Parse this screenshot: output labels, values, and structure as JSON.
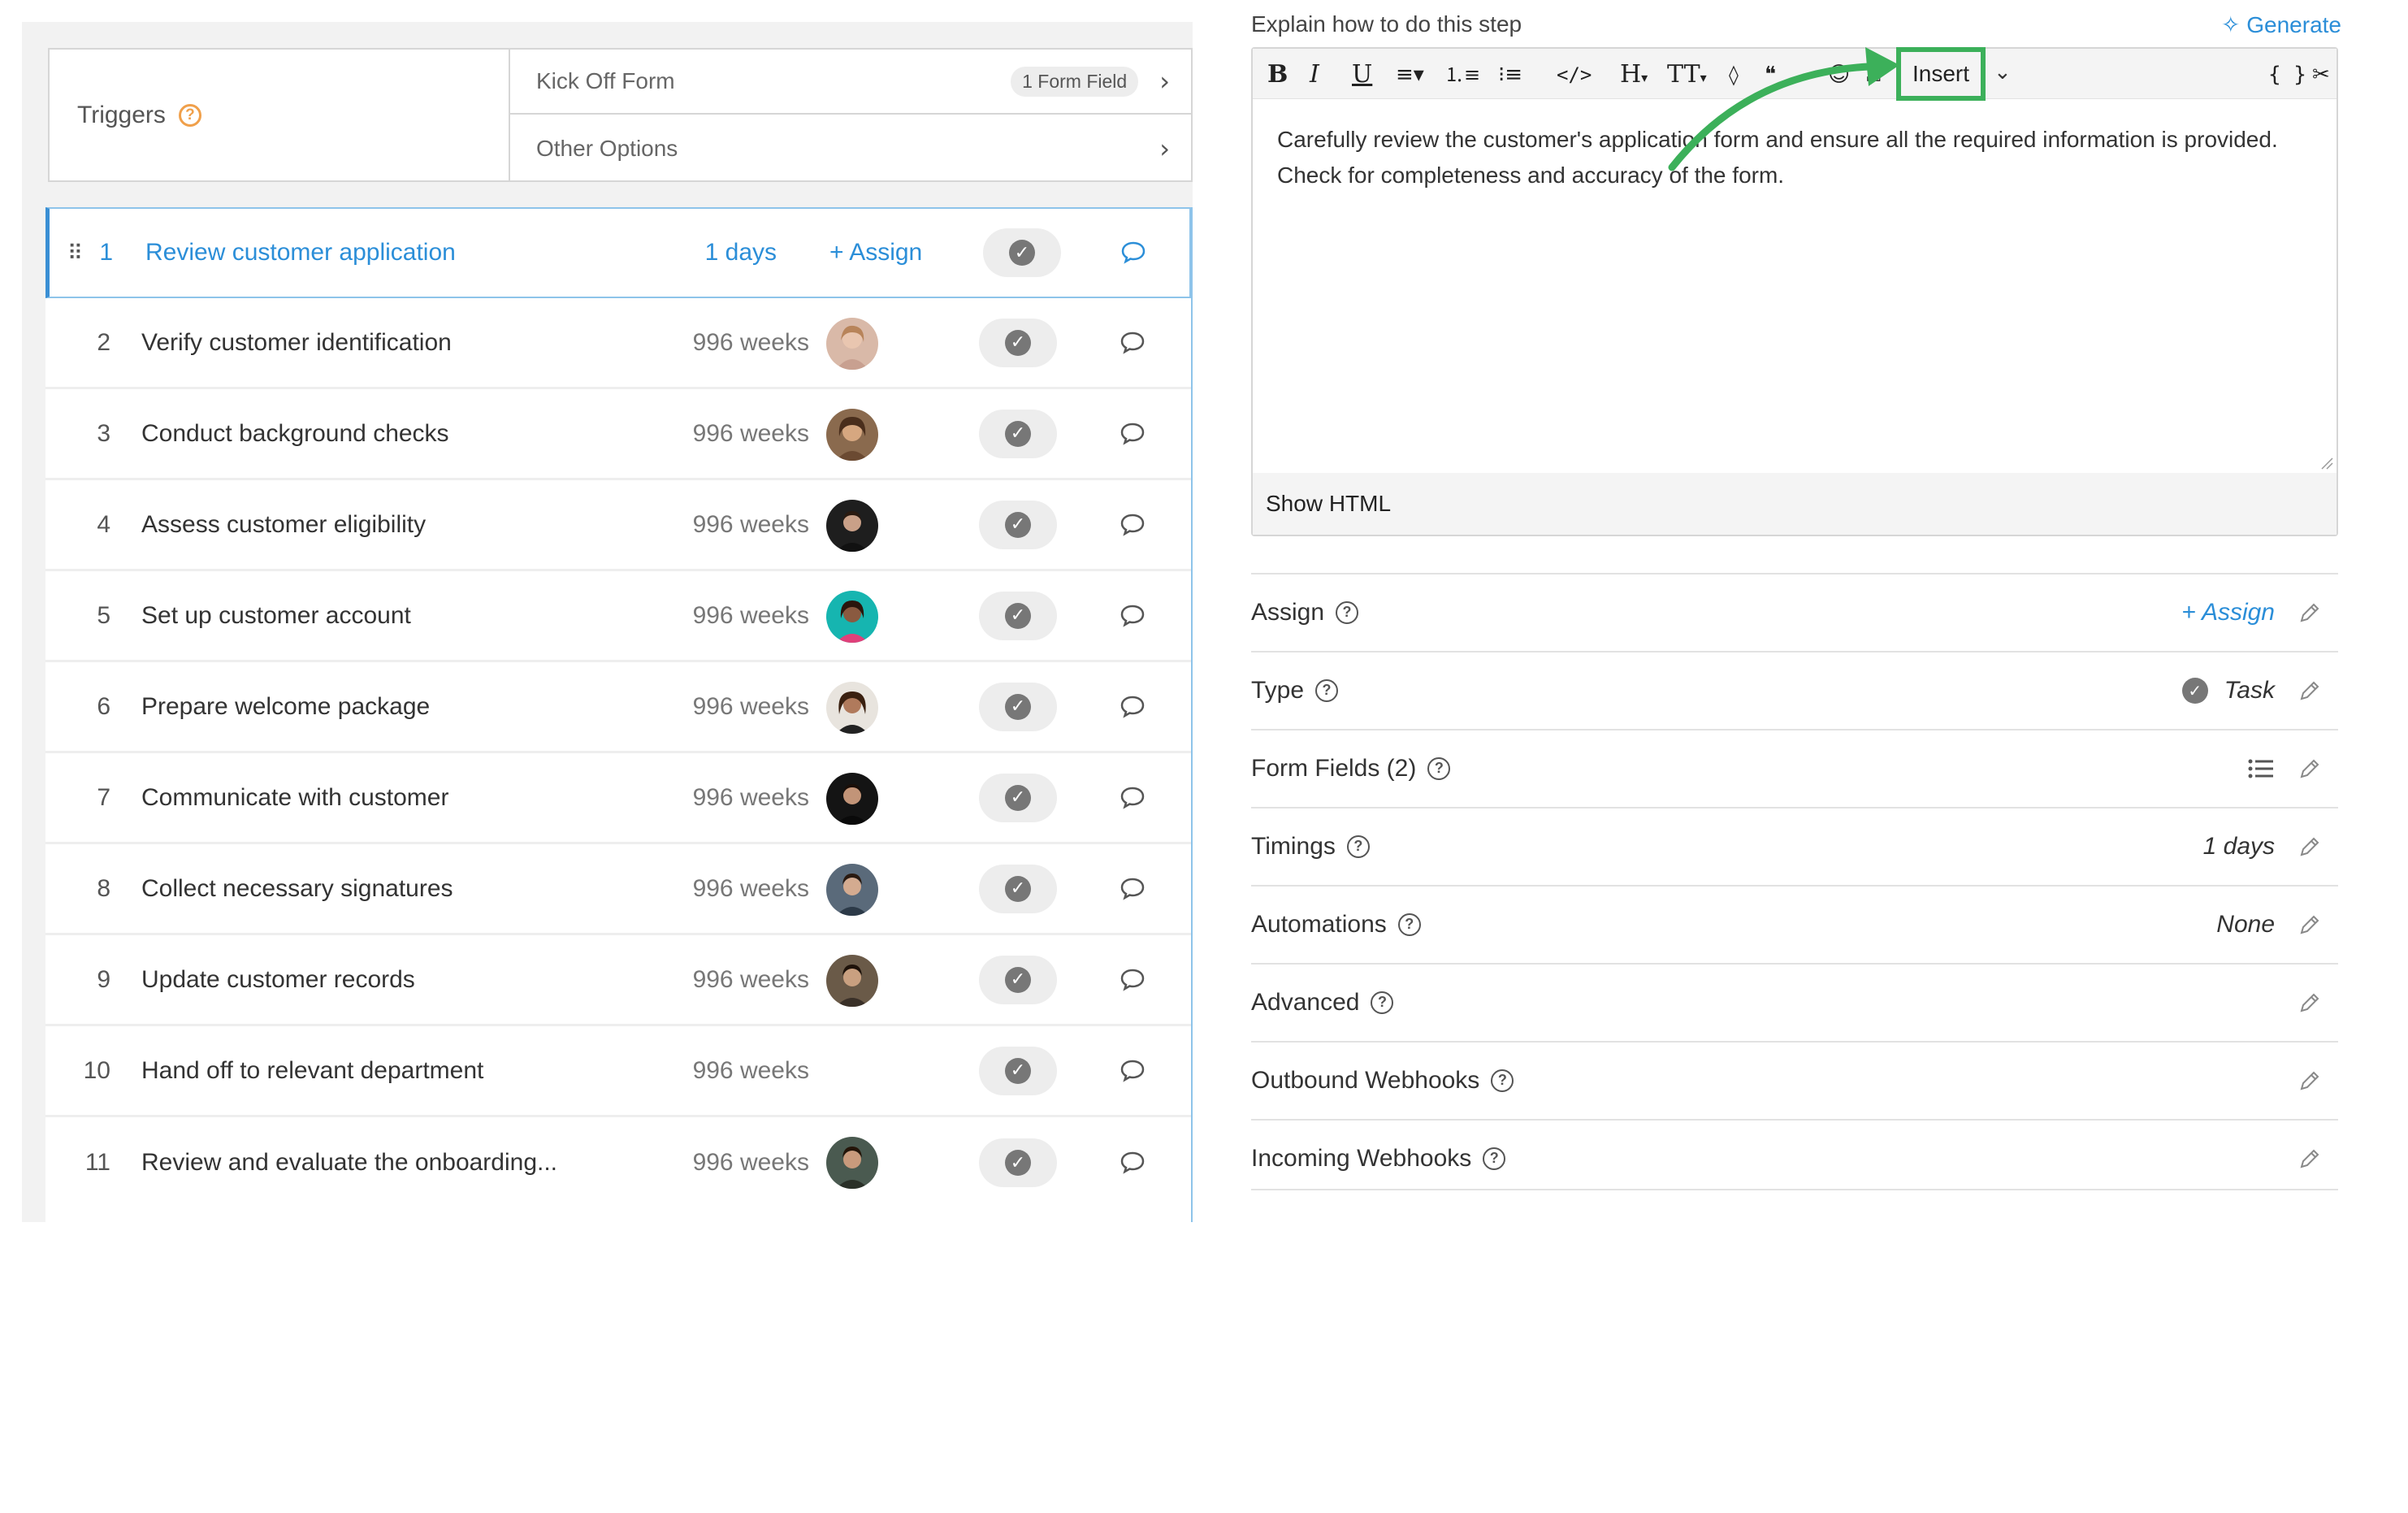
{
  "triggers": {
    "label": "Triggers",
    "help": "?",
    "rows": [
      {
        "label": "Kick Off Form",
        "badge": "1 Form Field"
      },
      {
        "label": "Other Options",
        "badge": ""
      }
    ]
  },
  "steps": [
    {
      "num": "1",
      "title": "Review customer application",
      "duration": "1 days",
      "assign": "+ Assign",
      "active": true
    },
    {
      "num": "2",
      "title": "Verify customer identification",
      "duration": "996 weeks"
    },
    {
      "num": "3",
      "title": "Conduct background checks",
      "duration": "996 weeks"
    },
    {
      "num": "4",
      "title": "Assess customer eligibility",
      "duration": "996 weeks"
    },
    {
      "num": "5",
      "title": "Set up customer account",
      "duration": "996 weeks"
    },
    {
      "num": "6",
      "title": "Prepare welcome package",
      "duration": "996 weeks"
    },
    {
      "num": "7",
      "title": "Communicate with customer",
      "duration": "996 weeks"
    },
    {
      "num": "8",
      "title": "Collect necessary signatures",
      "duration": "996 weeks"
    },
    {
      "num": "9",
      "title": "Update customer records",
      "duration": "996 weeks"
    },
    {
      "num": "10",
      "title": "Hand off to relevant department",
      "duration": "996 weeks"
    },
    {
      "num": "11",
      "title": "Review and evaluate the onboarding...",
      "duration": "996 weeks"
    }
  ],
  "editor": {
    "label": "Explain how to do this step",
    "generate": "Generate",
    "insert": "Insert",
    "content": "Carefully review the customer's application form and ensure all the required information is provided. Check for completeness and accuracy of the form.",
    "show_html": "Show HTML"
  },
  "properties": [
    {
      "label": "Assign",
      "value": "+ Assign"
    },
    {
      "label": "Type",
      "value": "Task"
    },
    {
      "label": "Form Fields (2)",
      "value": ""
    },
    {
      "label": "Timings",
      "value": "1 days"
    },
    {
      "label": "Automations",
      "value": "None"
    },
    {
      "label": "Advanced",
      "value": ""
    },
    {
      "label": "Outbound Webhooks",
      "value": ""
    },
    {
      "label": "Incoming Webhooks",
      "value": ""
    }
  ],
  "colors": {
    "accent": "#2b8ed8",
    "highlight": "#3cb05a",
    "help_orange": "#f0a04b"
  }
}
